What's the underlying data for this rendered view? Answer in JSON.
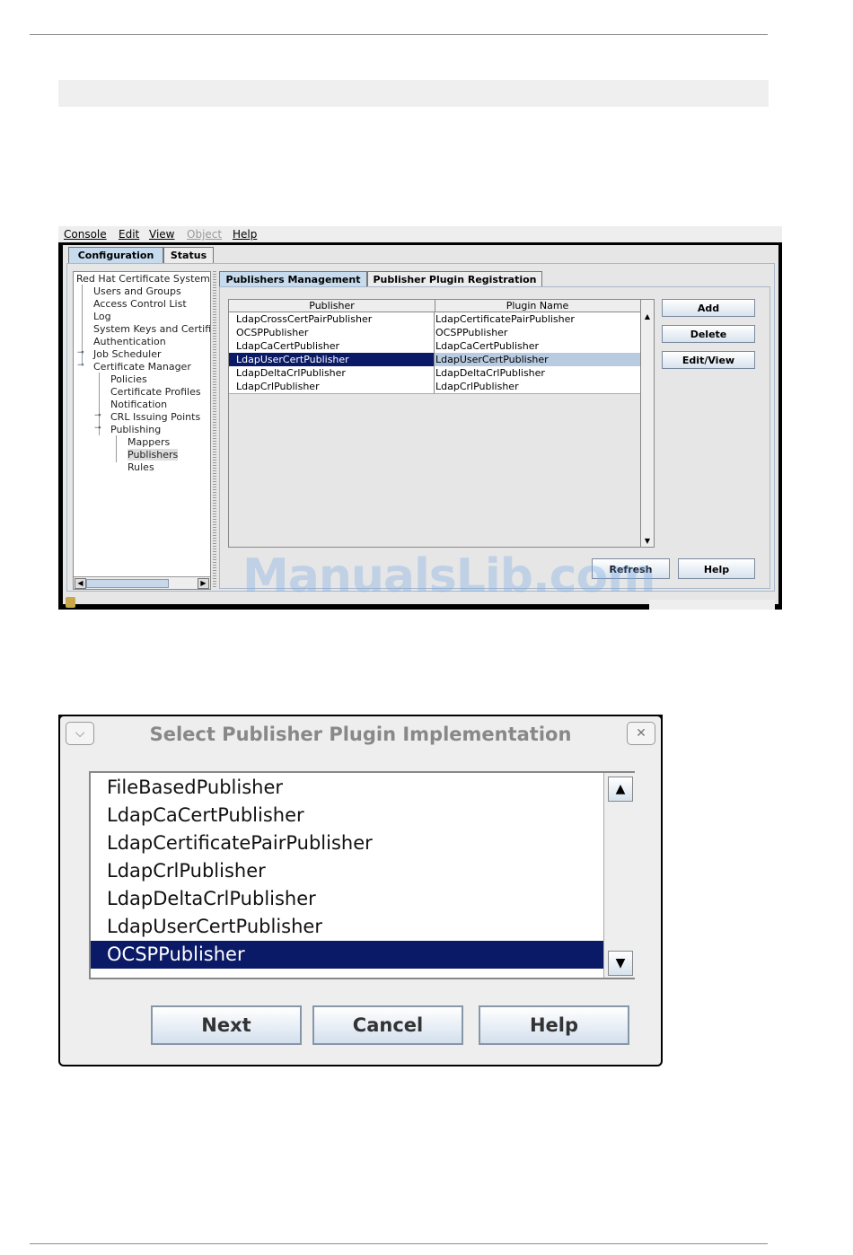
{
  "console": {
    "menu": [
      {
        "label": "Console",
        "disabled": false
      },
      {
        "label": "Edit",
        "disabled": false
      },
      {
        "label": "View",
        "disabled": false
      },
      {
        "label": "Object",
        "disabled": true
      },
      {
        "label": "Help",
        "disabled": false
      }
    ],
    "tabs": [
      "Configuration",
      "Status"
    ],
    "tree": [
      "Red Hat Certificate System:",
      "Users and Groups",
      "Access Control List",
      "Log",
      "System Keys and Certifi",
      "Authentication",
      "Job Scheduler",
      "Certificate Manager",
      "Policies",
      "Certificate Profiles",
      "Notification",
      "CRL Issuing Points",
      "Publishing",
      "Mappers",
      "Publishers",
      "Rules"
    ],
    "subtabs": [
      "Publishers Management",
      "Publisher Plugin Registration"
    ],
    "table": {
      "headers": [
        "Publisher",
        "Plugin Name"
      ],
      "rows": [
        [
          "LdapCrossCertPairPublisher",
          "LdapCertificatePairPublisher"
        ],
        [
          "OCSPPublisher",
          "OCSPPublisher"
        ],
        [
          "LdapCaCertPublisher",
          "LdapCaCertPublisher"
        ],
        [
          "LdapUserCertPublisher",
          "LdapUserCertPublisher"
        ],
        [
          "LdapDeltaCrlPublisher",
          "LdapDeltaCrlPublisher"
        ],
        [
          "LdapCrlPublisher",
          "LdapCrlPublisher"
        ]
      ],
      "selected_row": 3
    },
    "buttons": {
      "add": "Add",
      "delete": "Delete",
      "edit_view": "Edit/View",
      "refresh": "Refresh",
      "help": "Help"
    },
    "watermark": "ManualsLib.com"
  },
  "dialog": {
    "title": "Select Publisher Plugin Implementation",
    "items": [
      "FileBasedPublisher",
      "LdapCaCertPublisher",
      "LdapCertificatePairPublisher",
      "LdapCrlPublisher",
      "LdapDeltaCrlPublisher",
      "LdapUserCertPublisher",
      "OCSPPublisher"
    ],
    "selected_item": 6,
    "buttons": {
      "next": "Next",
      "cancel": "Cancel",
      "help": "Help"
    },
    "icons": {
      "menu": "chevron-down-icon",
      "close": "close-icon"
    }
  },
  "colors": {
    "selection": "#0a1a66",
    "tab_active": "#c7dbee"
  }
}
